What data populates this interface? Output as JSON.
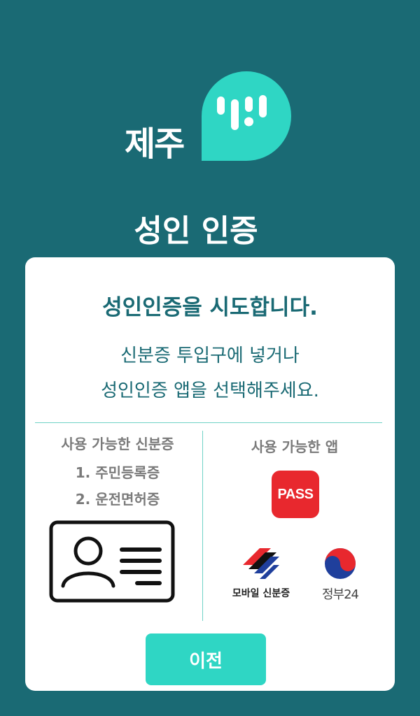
{
  "logo": {
    "text": "제주",
    "icon": "jeju-speech-bubble-logo",
    "color": "#2fd6c4"
  },
  "page": {
    "title": "성인 인증"
  },
  "card": {
    "headline": "성인인증을 시도합니다.",
    "subtitle_line1": "신분증 투입구에 넣거나",
    "subtitle_line2": "성인인증 앱을 선택해주세요."
  },
  "left_column": {
    "title": "사용 가능한 신분증",
    "items": [
      "1. 주민등록증",
      "2. 운전면허증"
    ],
    "icon": "id-card-icon"
  },
  "right_column": {
    "title": "사용 가능한 앱",
    "apps": [
      {
        "label": "PASS",
        "icon": "pass-app-icon",
        "color": "#e8282e"
      },
      {
        "label": "모바일 신분증",
        "icon": "mobile-id-icon"
      },
      {
        "label": "정부24",
        "icon": "gov24-icon"
      }
    ]
  },
  "buttons": {
    "prev": "이전"
  },
  "colors": {
    "background": "#1a6a74",
    "accent": "#2fd6c4",
    "text_primary": "#1a6a74"
  }
}
